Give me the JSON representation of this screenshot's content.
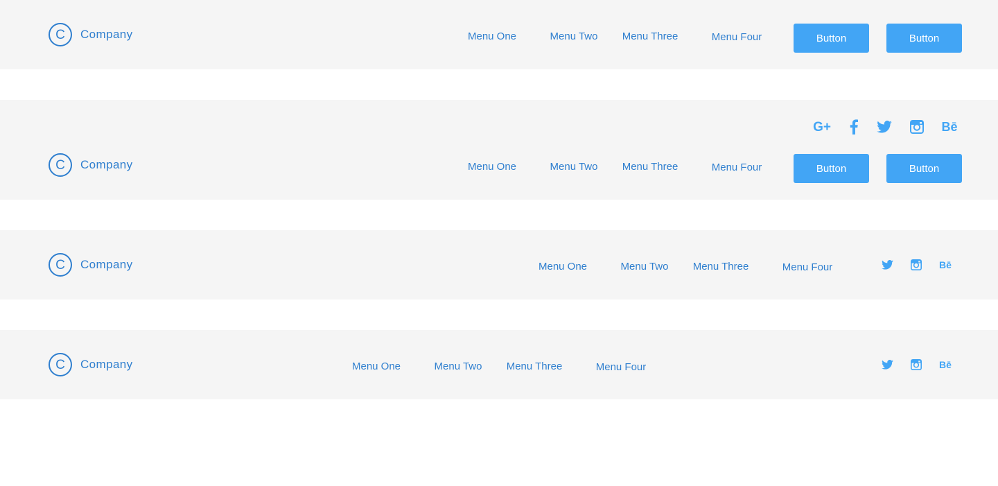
{
  "colors": {
    "bar_background": "#f5f5f5",
    "brand_text": "#2f7fcf",
    "button_background": "#42a5f5",
    "button_text": "#ffffff",
    "icon_color": "#42a5f5"
  },
  "headers": [
    {
      "logo": {
        "mark": "C",
        "text": "Company"
      },
      "menu": [
        "Menu One",
        "Menu Two",
        "Menu Three",
        "Menu Four"
      ],
      "buttons": [
        "Button",
        "Button"
      ]
    },
    {
      "social": [
        "google-plus-icon",
        "facebook-icon",
        "twitter-icon",
        "instagram-icon",
        "behance-icon"
      ],
      "social_text": {
        "google_plus": "G+",
        "behance": "Bē"
      },
      "logo": {
        "mark": "C",
        "text": "Company"
      },
      "menu": [
        "Menu One",
        "Menu Two",
        "Menu Three",
        "Menu Four"
      ],
      "buttons": [
        "Button",
        "Button"
      ]
    },
    {
      "logo": {
        "mark": "C",
        "text": "Company"
      },
      "menu": [
        "Menu One",
        "Menu Two",
        "Menu Three",
        "Menu Four"
      ],
      "social": [
        "twitter-icon",
        "instagram-icon",
        "behance-icon"
      ],
      "social_text": {
        "behance": "Bē"
      }
    },
    {
      "logo": {
        "mark": "C",
        "text": "Company"
      },
      "menu": [
        "Menu One",
        "Menu Two",
        "Menu Three",
        "Menu Four"
      ],
      "social": [
        "twitter-icon",
        "instagram-icon",
        "behance-icon"
      ],
      "social_text": {
        "behance": "Bē"
      }
    }
  ]
}
